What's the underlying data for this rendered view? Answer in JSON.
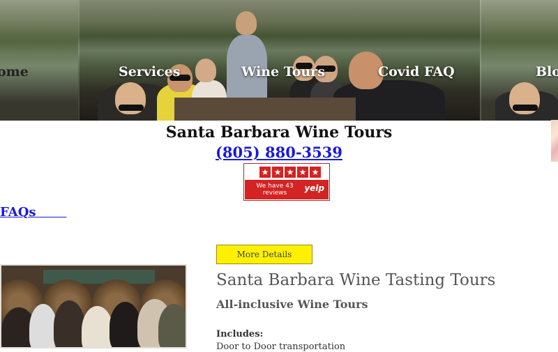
{
  "nav": {
    "items": [
      {
        "label": "Home"
      },
      {
        "label": "Services"
      },
      {
        "label": "Wine Tours"
      },
      {
        "label": "Covid FAQ"
      },
      {
        "label": "Blog"
      }
    ]
  },
  "header": {
    "title": "Santa Barbara Wine Tours",
    "phone": "(805) 880-3539"
  },
  "yelp": {
    "stars": "★",
    "reviews_text": "We have 43 reviews",
    "logo": "yelp"
  },
  "links": {
    "faqs": "FAQs"
  },
  "tour": {
    "button_label": "More Details",
    "title": "Santa Barbara Wine Tasting Tours",
    "subtitle": "All-inclusive Wine Tours",
    "includes_label": "Includes:",
    "first_item": "Door to Door transportation"
  }
}
